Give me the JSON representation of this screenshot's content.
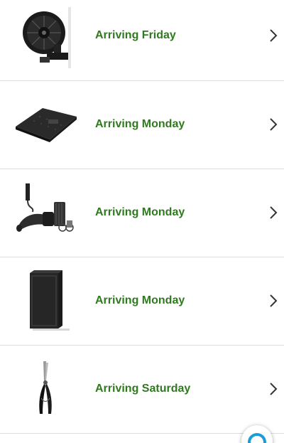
{
  "orders": [
    {
      "status": "Arriving Friday",
      "image_icon": "clip-fan-icon"
    },
    {
      "status": "Arriving Monday",
      "image_icon": "led-grow-panel-icon"
    },
    {
      "status": "Arriving Monday",
      "image_icon": "inline-fan-filter-kit-icon"
    },
    {
      "status": "Arriving Monday",
      "image_icon": "grow-tent-icon"
    },
    {
      "status": "Arriving Saturday",
      "image_icon": "pruning-shears-icon"
    }
  ],
  "chevron_icon": "chevron-right-icon",
  "fab_icon": "chat-bubble-icon",
  "colors": {
    "status_green": "#2f7a1f",
    "divider": "#dcdcdc",
    "fab_accent": "#1e9bd7"
  }
}
